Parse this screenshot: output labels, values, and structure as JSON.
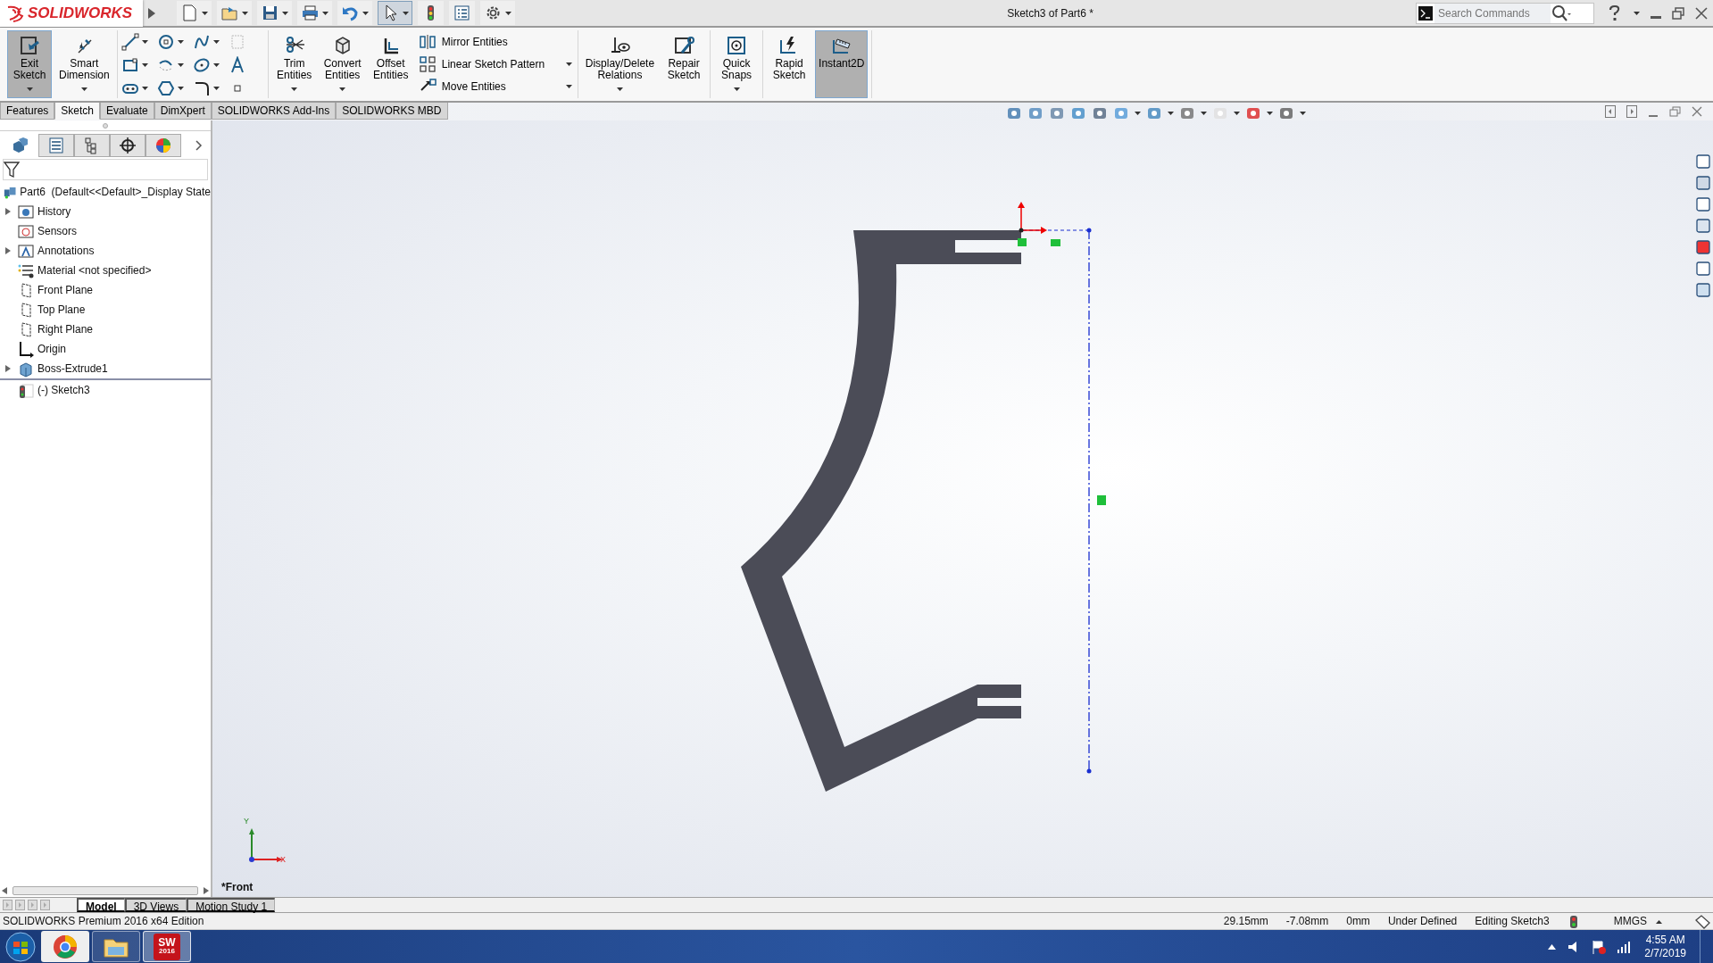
{
  "app": {
    "logo_text": "SOLIDWORKS"
  },
  "window": {
    "title": "Sketch3 of Part6 *"
  },
  "search": {
    "placeholder": "Search Commands"
  },
  "ribbon": [
    [
      {
        "kind": "large",
        "label": "Exit Sketch",
        "pressed": true,
        "dropdown": true
      },
      {
        "kind": "large",
        "label": "Smart Dimension",
        "pressed": false,
        "dropdown": true
      }
    ],
    [
      {
        "kind": "sketch_tools"
      }
    ],
    [
      {
        "kind": "large",
        "label": "Trim Entities",
        "pressed": false,
        "dropdown": true
      },
      {
        "kind": "large",
        "label": "Convert Entities",
        "pressed": false,
        "dropdown": true
      },
      {
        "kind": "large",
        "label": "Offset Entities",
        "pressed": false,
        "dropdown": false
      },
      {
        "kind": "stack",
        "items": [
          {
            "label": "Mirror Entities",
            "dropdown": false
          },
          {
            "label": "Linear Sketch Pattern",
            "dropdown": true
          },
          {
            "label": "Move Entities",
            "dropdown": true
          }
        ]
      }
    ],
    [
      {
        "kind": "large",
        "label": "Display/Delete Relations",
        "pressed": false,
        "dropdown": true
      },
      {
        "kind": "large",
        "label": "Repair Sketch",
        "pressed": false,
        "dropdown": false
      }
    ],
    [
      {
        "kind": "large",
        "label": "Quick Snaps",
        "pressed": false,
        "dropdown": true
      }
    ],
    [
      {
        "kind": "large",
        "label": "Rapid Sketch",
        "pressed": false,
        "dropdown": false
      },
      {
        "kind": "large",
        "label": "Instant2D",
        "pressed": true,
        "dropdown": false
      }
    ]
  ],
  "command_tabs": [
    {
      "label": "Features",
      "selected": false
    },
    {
      "label": "Sketch",
      "selected": true
    },
    {
      "label": "Evaluate",
      "selected": false
    },
    {
      "label": "DimXpert",
      "selected": false
    },
    {
      "label": "SOLIDWORKS Add-Ins",
      "selected": false
    },
    {
      "label": "SOLIDWORKS MBD",
      "selected": false
    }
  ],
  "panel_tabs": [
    {
      "selected": true
    },
    {
      "selected": false
    },
    {
      "selected": false
    },
    {
      "selected": false
    },
    {
      "selected": false
    }
  ],
  "feature_tree": {
    "label": "Part6  (Default<<Default>_Display State",
    "children": [
      {
        "label": "History",
        "expandable": true
      },
      {
        "label": "Sensors",
        "expandable": false
      },
      {
        "label": "Annotations",
        "expandable": true
      },
      {
        "label": "Material <not specified>",
        "expandable": false
      },
      {
        "label": "Front Plane",
        "expandable": false
      },
      {
        "label": "Top Plane",
        "expandable": false
      },
      {
        "label": "Right Plane",
        "expandable": false
      },
      {
        "label": "Origin",
        "expandable": false
      },
      {
        "label": "Boss-Extrude1",
        "expandable": true
      },
      {
        "label": "(-) Sketch3",
        "expandable": false
      }
    ]
  },
  "view": {
    "name": "*Front",
    "triad": {
      "x_label": "X",
      "y_label": "Y"
    }
  },
  "bottom_tabs": [
    {
      "label": "Model",
      "selected": true
    },
    {
      "label": "3D Views",
      "selected": false
    },
    {
      "label": "Motion Study 1",
      "selected": false
    }
  ],
  "status_bar": {
    "edition": "SOLIDWORKS Premium 2016 x64 Edition",
    "x": "29.15mm",
    "y": "-7.08mm",
    "z": "0mm",
    "definition": "Under Defined",
    "mode": "Editing Sketch3",
    "units": "MMGS"
  },
  "taskbar": {
    "apps": [
      {
        "kind": "browser",
        "running": false,
        "selected": false
      },
      {
        "kind": "files",
        "running": true,
        "selected": false
      },
      {
        "kind": "solidworks",
        "logo_text": "SW",
        "badge": "2016",
        "running": true,
        "selected": true
      }
    ],
    "clock": {
      "time": "4:55 AM",
      "date": "2/7/2019"
    }
  }
}
